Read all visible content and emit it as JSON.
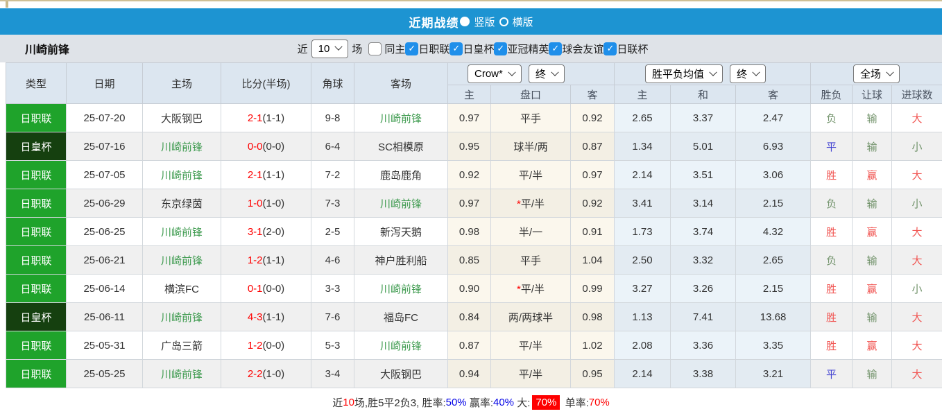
{
  "header": {
    "title": "近期战绩",
    "layout_options": [
      {
        "label": "竖版",
        "selected": true
      },
      {
        "label": "横版",
        "selected": false
      }
    ]
  },
  "toolbar": {
    "team_name": "川崎前锋",
    "near_label": "近",
    "matches_value": "10",
    "matches_label": "场",
    "same_home": {
      "label": "同主",
      "checked": false
    },
    "filters": [
      {
        "label": "日职联",
        "checked": true
      },
      {
        "label": "日皇杯",
        "checked": true
      },
      {
        "label": "亚冠精英",
        "checked": true
      },
      {
        "label": "球会友谊",
        "checked": true
      },
      {
        "label": "日联杯",
        "checked": true
      }
    ]
  },
  "table": {
    "columns": [
      "类型",
      "日期",
      "主场",
      "比分(半场)",
      "角球",
      "客场"
    ],
    "odds_header": {
      "bookmaker_select": "Crow*",
      "time_select_1": "终",
      "avg_select": "胜平负均值",
      "time_select_2": "终",
      "scope_select": "全场",
      "sub_columns": [
        "主",
        "盘口",
        "客",
        "主",
        "和",
        "客",
        "胜负",
        "让球",
        "进球数"
      ]
    },
    "rows": [
      {
        "competition": "日职联",
        "date": "25-07-20",
        "home": "大阪钢巴",
        "home_hl": false,
        "score": "2-1",
        "half": "(1-1)",
        "corners": "9-8",
        "away": "川崎前锋",
        "away_hl": true,
        "odds_home": "0.97",
        "handicap": "平手",
        "handicap_star": false,
        "odds_away": "0.92",
        "avg_home": "2.65",
        "avg_draw": "3.37",
        "avg_away": "2.47",
        "result": "负",
        "result_color": "green",
        "handicap_result": "输",
        "handicap_result_color": "green",
        "goals": "大",
        "goals_color": "red"
      },
      {
        "competition": "日皇杯",
        "date": "25-07-16",
        "home": "川崎前锋",
        "home_hl": true,
        "score": "0-0",
        "half": "(0-0)",
        "corners": "6-4",
        "away": "SC相模原",
        "away_hl": false,
        "odds_home": "0.95",
        "handicap": "球半/两",
        "handicap_star": false,
        "odds_away": "0.87",
        "avg_home": "1.34",
        "avg_draw": "5.01",
        "avg_away": "6.93",
        "result": "平",
        "result_color": "blue",
        "handicap_result": "输",
        "handicap_result_color": "green",
        "goals": "小",
        "goals_color": "green"
      },
      {
        "competition": "日职联",
        "date": "25-07-05",
        "home": "川崎前锋",
        "home_hl": true,
        "score": "2-1",
        "half": "(1-1)",
        "corners": "7-2",
        "away": "鹿岛鹿角",
        "away_hl": false,
        "odds_home": "0.92",
        "handicap": "平/半",
        "handicap_star": false,
        "odds_away": "0.97",
        "avg_home": "2.14",
        "avg_draw": "3.51",
        "avg_away": "3.06",
        "result": "胜",
        "result_color": "red",
        "handicap_result": "赢",
        "handicap_result_color": "red",
        "goals": "大",
        "goals_color": "red"
      },
      {
        "competition": "日职联",
        "date": "25-06-29",
        "home": "东京绿茵",
        "home_hl": false,
        "score": "1-0",
        "half": "(1-0)",
        "corners": "7-3",
        "away": "川崎前锋",
        "away_hl": true,
        "odds_home": "0.97",
        "handicap": "平/半",
        "handicap_star": true,
        "odds_away": "0.92",
        "avg_home": "3.41",
        "avg_draw": "3.14",
        "avg_away": "2.15",
        "result": "负",
        "result_color": "green",
        "handicap_result": "输",
        "handicap_result_color": "green",
        "goals": "小",
        "goals_color": "green"
      },
      {
        "competition": "日职联",
        "date": "25-06-25",
        "home": "川崎前锋",
        "home_hl": true,
        "score": "3-1",
        "half": "(2-0)",
        "corners": "2-5",
        "away": "新泻天鹅",
        "away_hl": false,
        "odds_home": "0.98",
        "handicap": "半/一",
        "handicap_star": false,
        "odds_away": "0.91",
        "avg_home": "1.73",
        "avg_draw": "3.74",
        "avg_away": "4.32",
        "result": "胜",
        "result_color": "red",
        "handicap_result": "赢",
        "handicap_result_color": "red",
        "goals": "大",
        "goals_color": "red"
      },
      {
        "competition": "日职联",
        "date": "25-06-21",
        "home": "川崎前锋",
        "home_hl": true,
        "score": "1-2",
        "half": "(1-1)",
        "corners": "4-6",
        "away": "神户胜利船",
        "away_hl": false,
        "odds_home": "0.85",
        "handicap": "平手",
        "handicap_star": false,
        "odds_away": "1.04",
        "avg_home": "2.50",
        "avg_draw": "3.32",
        "avg_away": "2.65",
        "result": "负",
        "result_color": "green",
        "handicap_result": "输",
        "handicap_result_color": "green",
        "goals": "大",
        "goals_color": "red"
      },
      {
        "competition": "日职联",
        "date": "25-06-14",
        "home": "横滨FC",
        "home_hl": false,
        "score": "0-1",
        "half": "(0-0)",
        "corners": "3-3",
        "away": "川崎前锋",
        "away_hl": true,
        "odds_home": "0.90",
        "handicap": "平/半",
        "handicap_star": true,
        "odds_away": "0.99",
        "avg_home": "3.27",
        "avg_draw": "3.26",
        "avg_away": "2.15",
        "result": "胜",
        "result_color": "red",
        "handicap_result": "赢",
        "handicap_result_color": "red",
        "goals": "小",
        "goals_color": "green"
      },
      {
        "competition": "日皇杯",
        "date": "25-06-11",
        "home": "川崎前锋",
        "home_hl": true,
        "score": "4-3",
        "half": "(1-1)",
        "corners": "7-6",
        "away": "福岛FC",
        "away_hl": false,
        "odds_home": "0.84",
        "handicap": "两/两球半",
        "handicap_star": false,
        "odds_away": "0.98",
        "avg_home": "1.13",
        "avg_draw": "7.41",
        "avg_away": "13.68",
        "result": "胜",
        "result_color": "red",
        "handicap_result": "输",
        "handicap_result_color": "green",
        "goals": "大",
        "goals_color": "red"
      },
      {
        "competition": "日职联",
        "date": "25-05-31",
        "home": "广岛三箭",
        "home_hl": false,
        "score": "1-2",
        "half": "(0-0)",
        "corners": "5-3",
        "away": "川崎前锋",
        "away_hl": true,
        "odds_home": "0.87",
        "handicap": "平/半",
        "handicap_star": false,
        "odds_away": "1.02",
        "avg_home": "2.08",
        "avg_draw": "3.36",
        "avg_away": "3.35",
        "result": "胜",
        "result_color": "red",
        "handicap_result": "赢",
        "handicap_result_color": "red",
        "goals": "大",
        "goals_color": "red"
      },
      {
        "competition": "日职联",
        "date": "25-05-25",
        "home": "川崎前锋",
        "home_hl": true,
        "score": "2-2",
        "half": "(1-0)",
        "corners": "3-4",
        "away": "大阪钢巴",
        "away_hl": false,
        "odds_home": "0.94",
        "handicap": "平/半",
        "handicap_star": false,
        "odds_away": "0.95",
        "avg_home": "2.14",
        "avg_draw": "3.38",
        "avg_away": "3.21",
        "result": "平",
        "result_color": "blue",
        "handicap_result": "输",
        "handicap_result_color": "green",
        "goals": "大",
        "goals_color": "red"
      }
    ]
  },
  "footer": {
    "parts": [
      {
        "text": "近",
        "style": "plain"
      },
      {
        "text": "10",
        "style": "red"
      },
      {
        "text": "场,胜5平2负3, 胜率:",
        "style": "plain"
      },
      {
        "text": "50%",
        "style": "blue"
      },
      {
        "text": " 赢率:",
        "style": "plain"
      },
      {
        "text": "40%",
        "style": "blue"
      },
      {
        "text": " 大:",
        "style": "plain"
      },
      {
        "text": "70%",
        "style": "badge"
      },
      {
        "text": " 单率:",
        "style": "plain"
      },
      {
        "text": "70%",
        "style": "red"
      }
    ]
  },
  "colors": {
    "competition": {
      "日职联": "#1fa32b",
      "日皇杯": "#15400f"
    },
    "accent_blue": "#1d94d2",
    "score_red": "#fe0000",
    "team_green": "#3d9a4e",
    "result_red": "#f15552",
    "result_green": "#71926a",
    "result_blue": "#4646d2"
  }
}
